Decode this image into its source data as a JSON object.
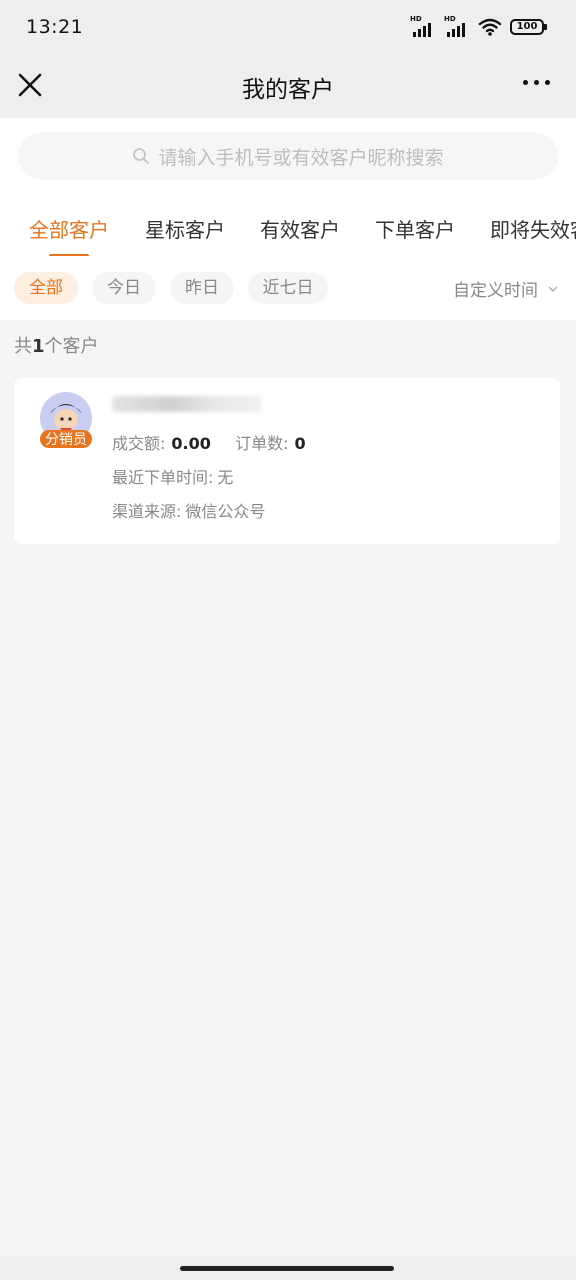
{
  "status_bar": {
    "time": "13:21",
    "signal1_label": "HD",
    "signal2_label": "HD",
    "battery": "100"
  },
  "nav": {
    "title": "我的客户",
    "close_icon": "close-icon",
    "more_icon": "more-icon"
  },
  "search": {
    "placeholder": "请输入手机号或有效客户昵称搜索"
  },
  "tabs": [
    {
      "label": "全部客户",
      "active": true
    },
    {
      "label": "星标客户",
      "active": false
    },
    {
      "label": "有效客户",
      "active": false
    },
    {
      "label": "下单客户",
      "active": false
    },
    {
      "label": "即将失效客",
      "active": false
    }
  ],
  "filters": {
    "chips": [
      {
        "label": "全部",
        "active": true
      },
      {
        "label": "今日",
        "active": false
      },
      {
        "label": "昨日",
        "active": false
      },
      {
        "label": "近七日",
        "active": false
      }
    ],
    "custom_time": "自定义时间"
  },
  "summary": {
    "prefix": "共",
    "count": "1",
    "suffix": "个客户"
  },
  "customers": [
    {
      "badge": "分销员",
      "amount_label": "成交额:",
      "amount_value": "0.00",
      "orders_label": "订单数:",
      "orders_value": "0",
      "last_order_label": "最近下单时间:",
      "last_order_value": "无",
      "source_label": "渠道来源:",
      "source_value": "微信公众号"
    }
  ],
  "colors": {
    "accent": "#e8741e",
    "background": "#f5f5f5",
    "header": "#eeeeee"
  }
}
